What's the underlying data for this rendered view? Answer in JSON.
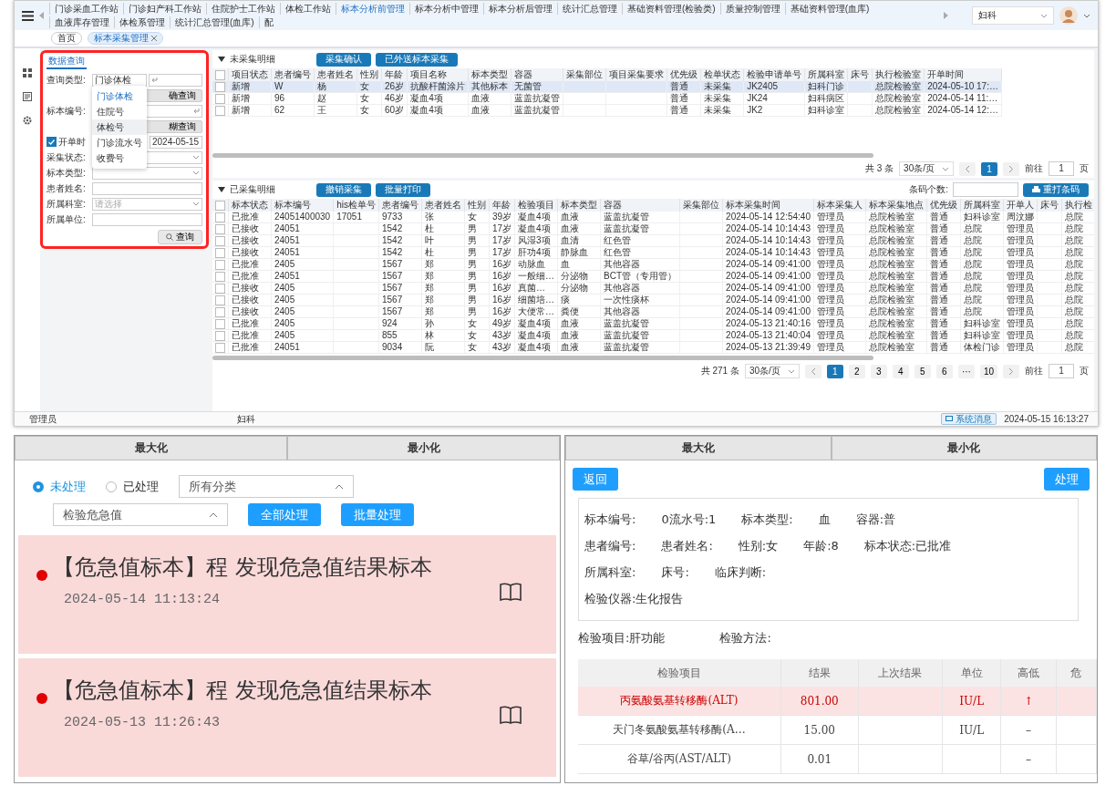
{
  "main_window": {
    "nav_tabs": [
      {
        "label": "门诊采血工作站",
        "selected": false
      },
      {
        "label": "门诊妇产科工作站",
        "selected": false
      },
      {
        "label": "住院护士工作站",
        "selected": false
      },
      {
        "label": "体检工作站",
        "selected": false
      },
      {
        "label": "标本分析前管理",
        "selected": true
      },
      {
        "label": "标本分析中管理",
        "selected": false
      },
      {
        "label": "标本分析后管理",
        "selected": false
      },
      {
        "label": "统计汇总管理",
        "selected": false
      },
      {
        "label": "基础资料管理(检验类)",
        "selected": false
      },
      {
        "label": "质量控制管理",
        "selected": false
      },
      {
        "label": "基础资料管理(血库)",
        "selected": false
      },
      {
        "label": "血液库存管理",
        "selected": false
      },
      {
        "label": "体检系管理",
        "selected": false
      },
      {
        "label": "统计汇总管理(血库)",
        "selected": false
      },
      {
        "label": "配",
        "selected": false
      }
    ],
    "department_select": {
      "value": "妇科"
    },
    "breadcrumb": [
      {
        "label": "首页",
        "selected": false,
        "closable": false
      },
      {
        "label": "标本采集管理",
        "selected": true,
        "closable": true
      }
    ],
    "query_panel": {
      "tab": "数据查询",
      "fields": [
        {
          "kind": "type-select",
          "label": "查询类型:",
          "value": "门诊体检"
        },
        {
          "kind": "button",
          "label": "确查询"
        },
        {
          "kind": "scan-input",
          "label": "标本编号:"
        },
        {
          "kind": "button",
          "label": "糊查询"
        },
        {
          "kind": "date",
          "label": "开单时",
          "checked": true,
          "value": "2024-05-15"
        },
        {
          "kind": "select",
          "label": "采集状态:"
        },
        {
          "kind": "select",
          "label": "标本类型:"
        },
        {
          "kind": "input",
          "label": "患者姓名:"
        },
        {
          "kind": "select",
          "label": "所属科室:",
          "placeholder": "请选择"
        },
        {
          "kind": "input",
          "label": "所属单位:"
        }
      ],
      "dropdown": [
        {
          "label": "门诊体检",
          "selected": true,
          "hovered": false
        },
        {
          "label": "住院号",
          "selected": false,
          "hovered": false
        },
        {
          "label": "体检号",
          "selected": false,
          "hovered": true
        },
        {
          "label": "门诊流水号",
          "selected": false,
          "hovered": false
        },
        {
          "label": "收费号",
          "selected": false,
          "hovered": false
        }
      ],
      "search_button": "查询"
    },
    "pending_section": {
      "title": "未采集明细",
      "expanded": true,
      "buttons": [
        "采集确认",
        "已外送标本采集"
      ],
      "all_checked": false,
      "columns": [
        "项目状态",
        "患者编号",
        "患者姓名",
        "性别",
        "年龄",
        "项目名称",
        "标本类型",
        "容器",
        "采集部位",
        "项目采集要求",
        "优先级",
        "检单状态",
        "检验申请单号",
        "所属科室",
        "床号",
        "执行检验室",
        "开单时间"
      ],
      "rows": [
        {
          "selected": true,
          "checked": false,
          "cells": [
            "新增",
            "W",
            "杨",
            "女",
            "26岁",
            "抗酸杆菌涂片",
            "其他标本",
            "无菌管",
            null,
            null,
            "普通",
            "未采集",
            "JK2405",
            "妇科门诊",
            null,
            "总院检验室",
            "2024-05-10 17:…"
          ]
        },
        {
          "selected": false,
          "checked": false,
          "cells": [
            "新增",
            "96",
            "赵",
            "女",
            "46岁",
            "凝血4项",
            "血液",
            "蓝盖抗凝管",
            null,
            null,
            "普通",
            "未采集",
            "JK24",
            "妇科病区",
            null,
            "总院检验室",
            "2024-05-14 11:…"
          ]
        },
        {
          "selected": false,
          "checked": false,
          "cells": [
            "新增",
            "62",
            "王",
            "女",
            "60岁",
            "凝血4项",
            "血液",
            "蓝盖抗凝管",
            null,
            null,
            "普通",
            "未采集",
            "JK2",
            "妇科诊室",
            null,
            "总院检验室",
            "2024-05-14 12:…"
          ]
        }
      ],
      "pagination": {
        "total": "共 3 条",
        "page_size": "30条/页",
        "pages": [
          {
            "label": "1",
            "selected": true
          }
        ],
        "jump_label": "前往",
        "jump_value": "1",
        "page_unit": "页"
      }
    },
    "collected_section": {
      "title": "已采集明细",
      "expanded": true,
      "buttons": [
        "撤销采集",
        "批量打印"
      ],
      "barcode_label": "条码个数:",
      "reprint_button": "重打条码",
      "all_checked": false,
      "columns": [
        "标本状态",
        "标本编号",
        "his检单号",
        "患者编号",
        "患者姓名",
        "性别",
        "年龄",
        "检验项目",
        "标本类型",
        "容器",
        "采集部位",
        "标本采集时间",
        "标本采集人",
        "标本采集地点",
        "优先级",
        "所属科室",
        "开单人",
        "床号",
        "执行检"
      ],
      "rows": [
        {
          "selected": false,
          "checked": false,
          "cells": [
            "已批准",
            "24051400030",
            "17051",
            "9733",
            "张",
            "女",
            "39岁",
            "凝血4项",
            "血液",
            "蓝盖抗凝管",
            null,
            "2024-05-14 12:54:40",
            "管理员",
            "总院检验室",
            "普通",
            "妇科诊室",
            "周汶娜",
            null,
            "总院"
          ]
        },
        {
          "selected": false,
          "checked": false,
          "cells": [
            "已接收",
            "24051",
            null,
            "1542",
            "杜",
            "男",
            "17岁",
            "凝血4项",
            "血液",
            "蓝盖抗凝管",
            null,
            "2024-05-14 10:14:43",
            "管理员",
            "总院检验室",
            "普通",
            "总院",
            "管理员",
            null,
            "总院"
          ]
        },
        {
          "selected": false,
          "checked": false,
          "cells": [
            "已接收",
            "24051",
            null,
            "1542",
            "叶",
            "男",
            "17岁",
            "风湿3项",
            "血清",
            "红色管",
            null,
            "2024-05-14 10:14:43",
            "管理员",
            "总院检验室",
            "普通",
            "总院",
            "管理员",
            null,
            "总院"
          ]
        },
        {
          "selected": false,
          "checked": false,
          "cells": [
            "已接收",
            "24051",
            null,
            "1542",
            "杜",
            "男",
            "17岁",
            "肝功4项",
            "静脉血",
            "红色管",
            null,
            "2024-05-14 10:14:43",
            "管理员",
            "总院检验室",
            "普通",
            "总院",
            "管理员",
            null,
            "总院"
          ]
        },
        {
          "selected": false,
          "checked": false,
          "cells": [
            "已批准",
            "2405",
            null,
            "1567",
            "郑",
            "男",
            "16岁",
            "动脉血",
            "血",
            "其他容器",
            null,
            "2024-05-14 09:41:00",
            "管理员",
            "总院检验室",
            "普通",
            "总院",
            "管理员",
            null,
            "总院"
          ]
        },
        {
          "selected": false,
          "checked": false,
          "cells": [
            "已批准",
            "24051",
            null,
            "1567",
            "郑",
            "男",
            "16岁",
            "一般细…",
            "分泌物",
            "BCT管（专用管）",
            null,
            "2024-05-14 09:41:00",
            "管理员",
            "总院检验室",
            "普通",
            "总院",
            "管理员",
            null,
            "总院"
          ]
        },
        {
          "selected": false,
          "checked": false,
          "cells": [
            "已接收",
            "2405",
            null,
            "1567",
            "郑",
            "男",
            "16岁",
            "真菌…",
            "分泌物",
            "其他容器",
            null,
            "2024-05-14 09:41:00",
            "管理员",
            "总院检验室",
            "普通",
            "总院",
            "管理员",
            null,
            "总院"
          ]
        },
        {
          "selected": false,
          "checked": false,
          "cells": [
            "已接收",
            "2405",
            null,
            "1567",
            "郑",
            "男",
            "16岁",
            "细菌培…",
            "痰",
            "一次性痰杯",
            null,
            "2024-05-14 09:41:00",
            "管理员",
            "总院检验室",
            "普通",
            "总院",
            "管理员",
            null,
            "总院"
          ]
        },
        {
          "selected": false,
          "checked": false,
          "cells": [
            "已接收",
            "2405",
            null,
            "1567",
            "郑",
            "男",
            "16岁",
            "大便常…",
            "粪便",
            "其他容器",
            null,
            "2024-05-14 09:41:00",
            "管理员",
            "总院检验室",
            "普通",
            "总院",
            "管理员",
            null,
            "总院"
          ]
        },
        {
          "selected": false,
          "checked": false,
          "cells": [
            "已批准",
            "2405",
            null,
            "924",
            "孙",
            "女",
            "49岁",
            "凝血4项",
            "血液",
            "蓝盖抗凝管",
            null,
            "2024-05-13 21:40:16",
            "管理员",
            "总院检验室",
            "普通",
            "妇科诊室",
            "管理员",
            null,
            "总院"
          ]
        },
        {
          "selected": false,
          "checked": false,
          "cells": [
            "已批准",
            "2405",
            null,
            "855",
            "林",
            "女",
            "43岁",
            "凝血4项",
            "血液",
            "蓝盖抗凝管",
            null,
            "2024-05-13 21:40:04",
            "管理员",
            "总院检验室",
            "普通",
            "妇科诊室",
            "管理员",
            null,
            "总院"
          ]
        },
        {
          "selected": false,
          "checked": false,
          "cells": [
            "已批准",
            "24051",
            null,
            "9034",
            "阮",
            "女",
            "43岁",
            "凝血4项",
            "血液",
            "蓝盖抗凝管",
            null,
            "2024-05-13 21:39:49",
            "管理员",
            "总院检验室",
            "普通",
            "体检门诊",
            "管理员",
            null,
            "总院"
          ]
        }
      ],
      "pagination": {
        "total": "共 271 条",
        "page_size": "30条/页",
        "pages": [
          {
            "label": "1",
            "selected": true
          },
          {
            "label": "2",
            "selected": false
          },
          {
            "label": "3",
            "selected": false
          },
          {
            "label": "4",
            "selected": false
          },
          {
            "label": "5",
            "selected": false
          },
          {
            "label": "6",
            "selected": false
          },
          {
            "label": "···",
            "selected": false
          },
          {
            "label": "10",
            "selected": false
          }
        ],
        "jump_label": "前往",
        "jump_value": "1",
        "page_unit": "页"
      }
    },
    "status_bar": {
      "user": "管理员",
      "department": "妇科",
      "message_button": "系统消息",
      "time": "2024-05-15 16:13:27"
    }
  },
  "alert_panel": {
    "tabs": [
      "最大化",
      "最小化"
    ],
    "radios": [
      {
        "label": "未处理",
        "selected": true
      },
      {
        "label": "已处理",
        "selected": false
      }
    ],
    "category_select": "所有分类",
    "type_select": "检验危急值",
    "buttons": [
      "全部处理",
      "批量处理"
    ],
    "alerts": [
      {
        "title": "【危急值标本】程 发现危急值结果标本",
        "time": "2024-05-14 11:13:24",
        "unread": true
      },
      {
        "title": "【危急值标本】程 发现危急值结果标本",
        "time": "2024-05-13 11:26:43",
        "unread": true
      }
    ]
  },
  "detail_panel": {
    "tabs": [
      "最大化",
      "最小化"
    ],
    "back_button": "返回",
    "process_button": "处理",
    "info_rows": [
      [
        "标本编号:",
        "0流水号:1",
        "标本类型:",
        "血",
        "容器:普"
      ],
      [
        "患者编号:",
        "患者姓名:",
        "性别:女",
        "年龄:8",
        "标本状态:已批准"
      ],
      [
        "所属科室:",
        "床号:",
        "临床判断:"
      ],
      [
        "检验仪器:生化报告"
      ]
    ],
    "test_item": "检验项目:肝功能",
    "test_method": "检验方法:",
    "columns": [
      "检验项目",
      "结果",
      "上次结果",
      "单位",
      "高低",
      "危"
    ],
    "rows": [
      {
        "abnormal": true,
        "cells": [
          "丙氨酸氨基转移酶(ALT)",
          "801.00",
          null,
          "IU/L",
          "↑"
        ]
      },
      {
        "abnormal": false,
        "cells": [
          "天门冬氨酸氨基转移酶(A…",
          "15.00",
          null,
          "IU/L",
          "–"
        ]
      },
      {
        "abnormal": false,
        "cells": [
          "谷草/谷丙(AST/ALT)",
          "0.01",
          null,
          null,
          "–"
        ]
      }
    ]
  }
}
